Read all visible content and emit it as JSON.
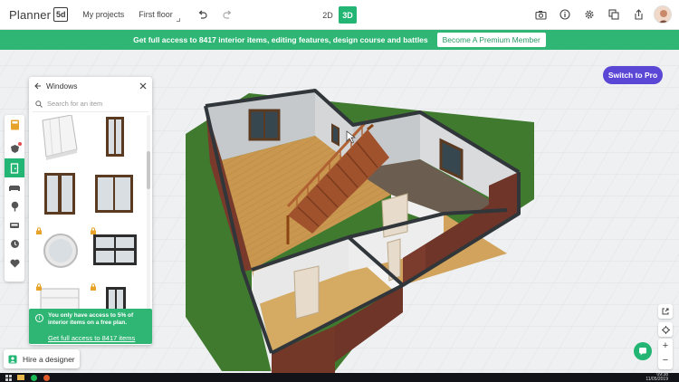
{
  "app": {
    "logo_text": "Planner",
    "logo_badge": "5d",
    "my_projects": "My projects",
    "floor": "First floor",
    "mode_2d": "2D",
    "mode_3d": "3D",
    "active_mode": "3D"
  },
  "banner": {
    "text": "Get full access to 8417 interior items, editing features, design course and battles",
    "button": "Become A Premium Member"
  },
  "panel": {
    "title": "Windows",
    "search_placeholder": "Search for an item"
  },
  "promo": {
    "text": "You only have access to 5% of interior items on a free plan.",
    "link": "Get full access to 8417 items"
  },
  "hire_button": "Hire a designer",
  "switch_pro": "Switch to Pro",
  "colors": {
    "accent": "#22b573",
    "banner": "#2fb574",
    "pro": "#5b47d6"
  },
  "taskbar": {
    "time": "09:38",
    "date": "11/05/2019"
  }
}
